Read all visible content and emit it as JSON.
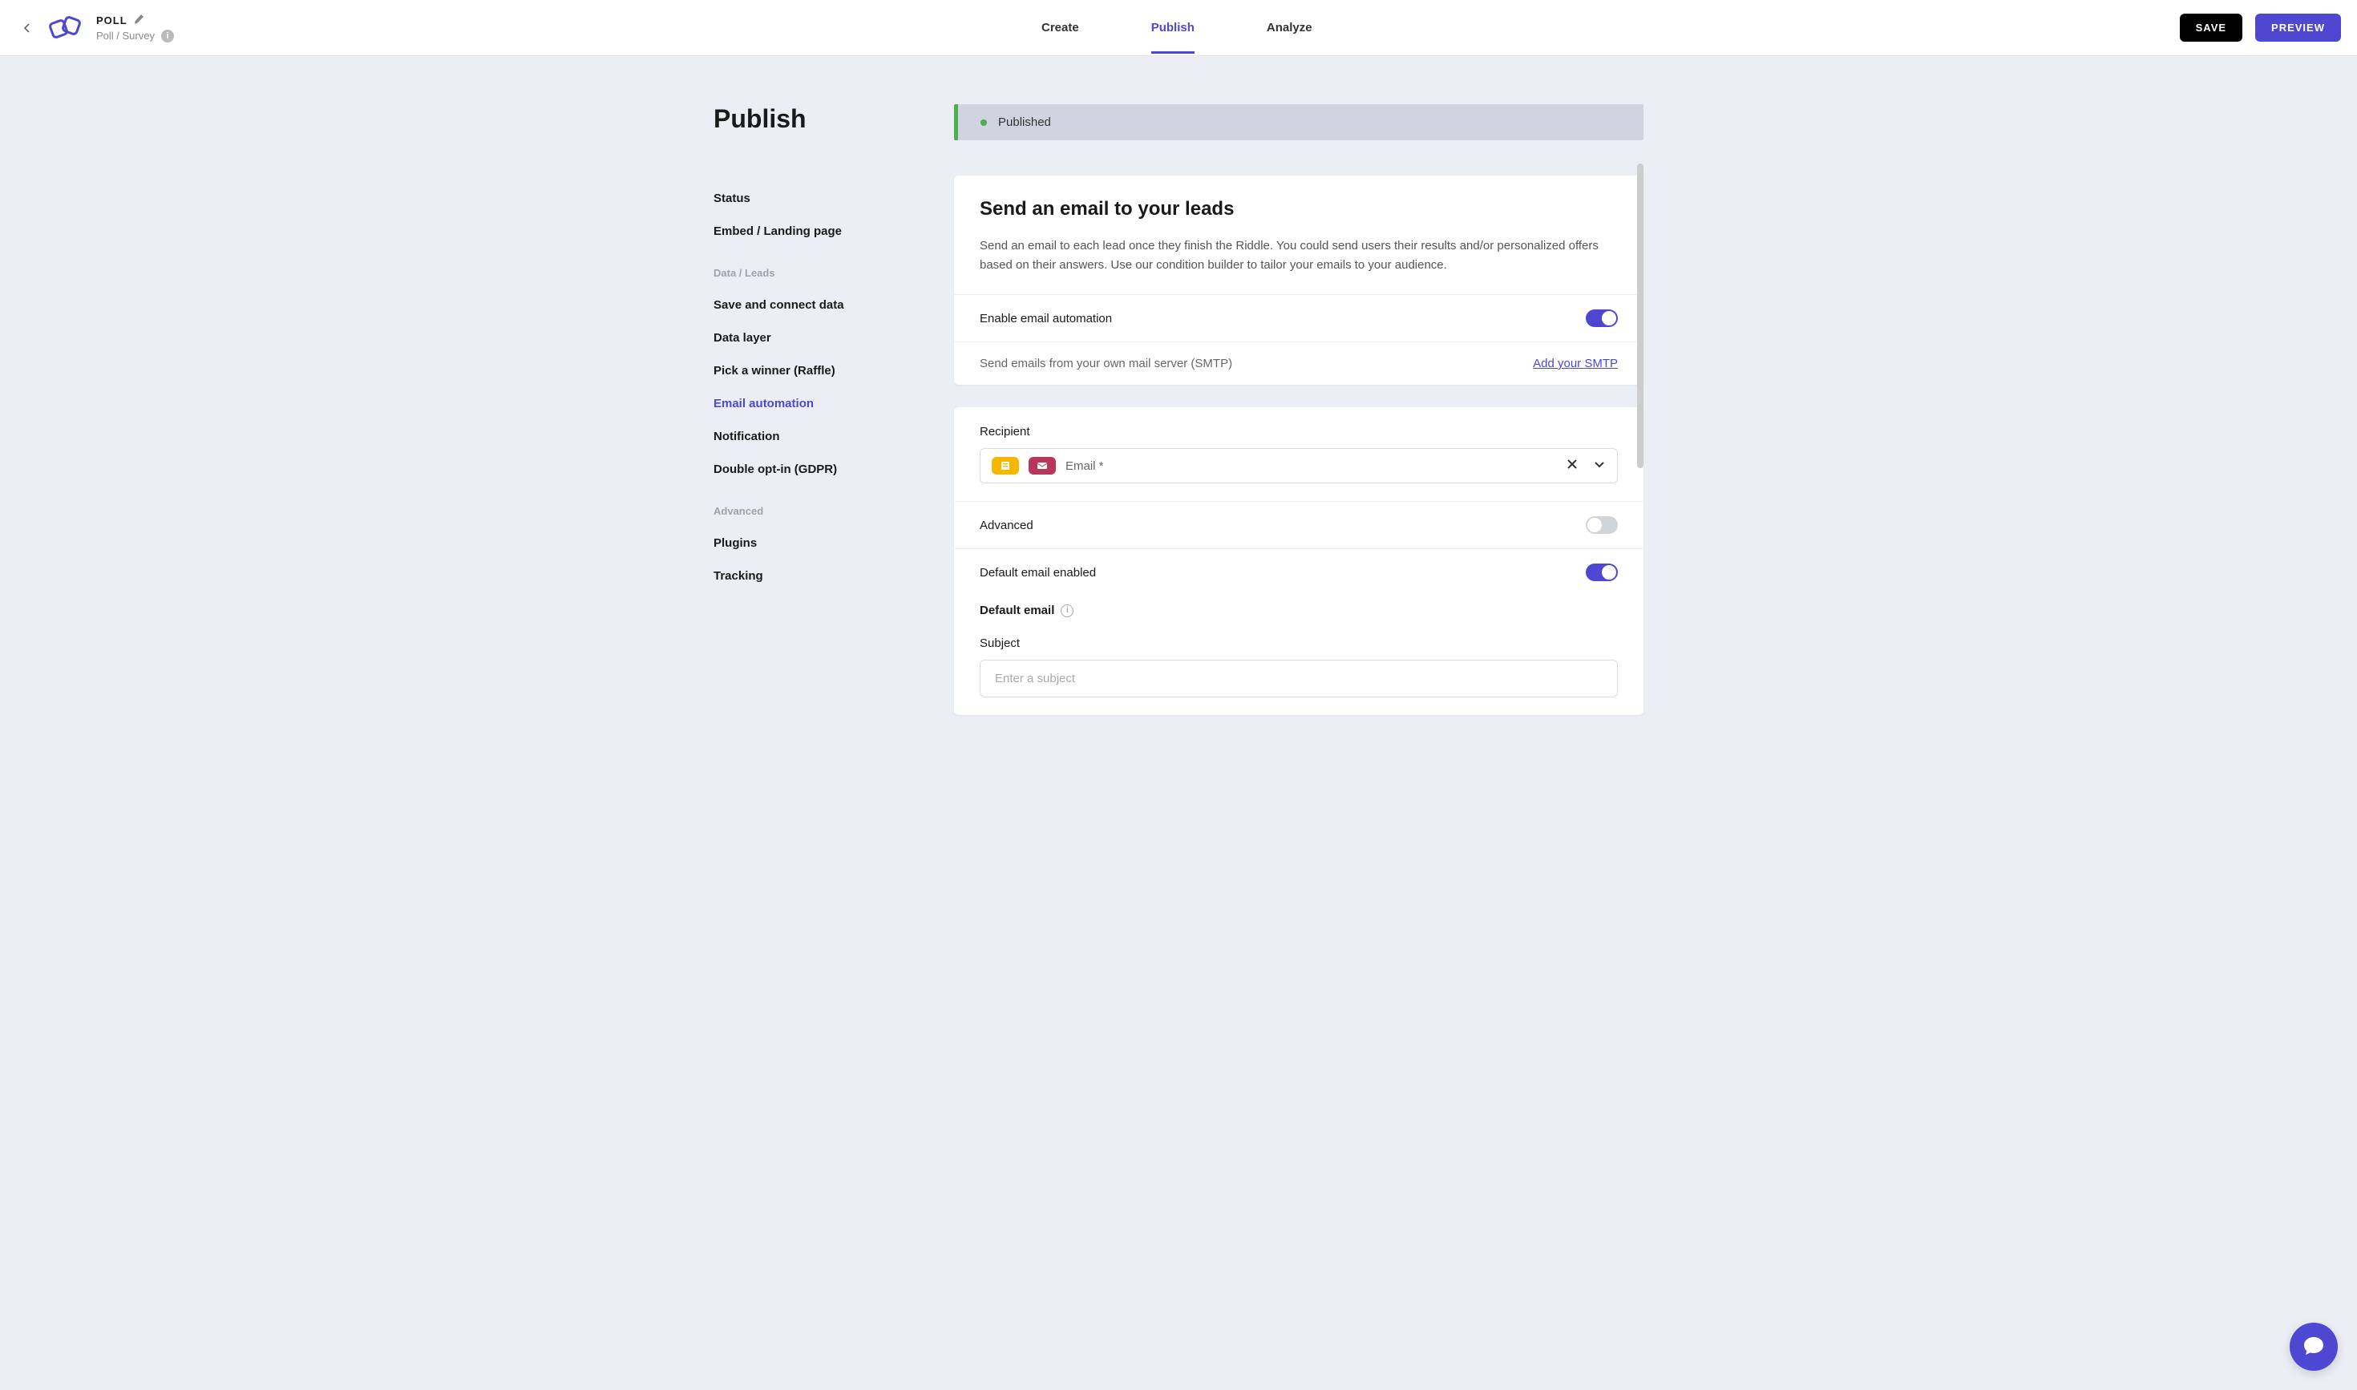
{
  "header": {
    "title": "POLL",
    "subtitle": "Poll / Survey",
    "tabs": [
      "Create",
      "Publish",
      "Analyze"
    ],
    "active_tab": 1,
    "save_label": "SAVE",
    "preview_label": "PREVIEW"
  },
  "page": {
    "heading": "Publish"
  },
  "sidebar": {
    "items": [
      {
        "label": "Status"
      },
      {
        "label": "Embed / Landing page"
      }
    ],
    "section_data": {
      "label": "Data / Leads",
      "items": [
        {
          "label": "Save and connect data"
        },
        {
          "label": "Data layer"
        },
        {
          "label": "Pick a winner (Raffle)"
        },
        {
          "label": "Email automation",
          "active": true
        },
        {
          "label": "Notification"
        },
        {
          "label": "Double opt-in (GDPR)"
        }
      ]
    },
    "section_advanced": {
      "label": "Advanced",
      "items": [
        {
          "label": "Plugins"
        },
        {
          "label": "Tracking"
        }
      ]
    }
  },
  "status": {
    "text": "Published"
  },
  "card1": {
    "title": "Send an email to your leads",
    "desc": "Send an email to each lead once they finish the Riddle. You could send users their results and/or personalized offers based on their answers. Use our condition builder to tailor your emails to your audience.",
    "enable_label": "Enable email automation",
    "smtp_label": "Send emails from your own mail server (SMTP)",
    "smtp_link": "Add your SMTP"
  },
  "card2": {
    "recipient_label": "Recipient",
    "recipient_value": "Email *",
    "advanced_label": "Advanced",
    "default_enabled_label": "Default email enabled",
    "default_email_label": "Default email",
    "subject_label": "Subject",
    "subject_placeholder": "Enter a subject"
  },
  "toggles": {
    "enable_automation": true,
    "advanced": false,
    "default_enabled": true
  },
  "colors": {
    "primary": "#4d47d1",
    "success": "#4caf50"
  }
}
